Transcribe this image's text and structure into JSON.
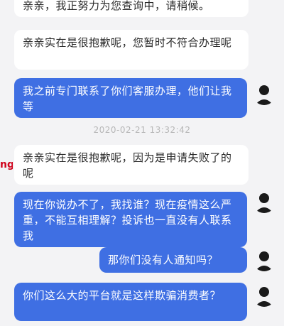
{
  "messages": [
    {
      "text": "亲亲，我正努力为您查询中，请稍候。"
    },
    {
      "text": "亲亲实在是很抱歉呢，您暂时不符合办理呢"
    },
    {
      "text": "我之前专门联系了你们客服办理，他们让我等"
    },
    {
      "text": "亲亲实在是很抱歉呢，因为是申请失败了的呢"
    },
    {
      "text": "现在你说办不了，我找谁？现在疫情这么严重，不能互相理解？投诉也一直没有人联系我"
    },
    {
      "text": "那你们没有人通知吗？"
    },
    {
      "text": "你们这么大的平台就是这样欺骗消费者？"
    }
  ],
  "timestamp": "2020-02-21 13:32:42",
  "side_fragment": "ng",
  "colors": {
    "user_bubble": "#3f6fe3",
    "agent_bubble": "#ffffff",
    "background": "#f3f3f5"
  }
}
